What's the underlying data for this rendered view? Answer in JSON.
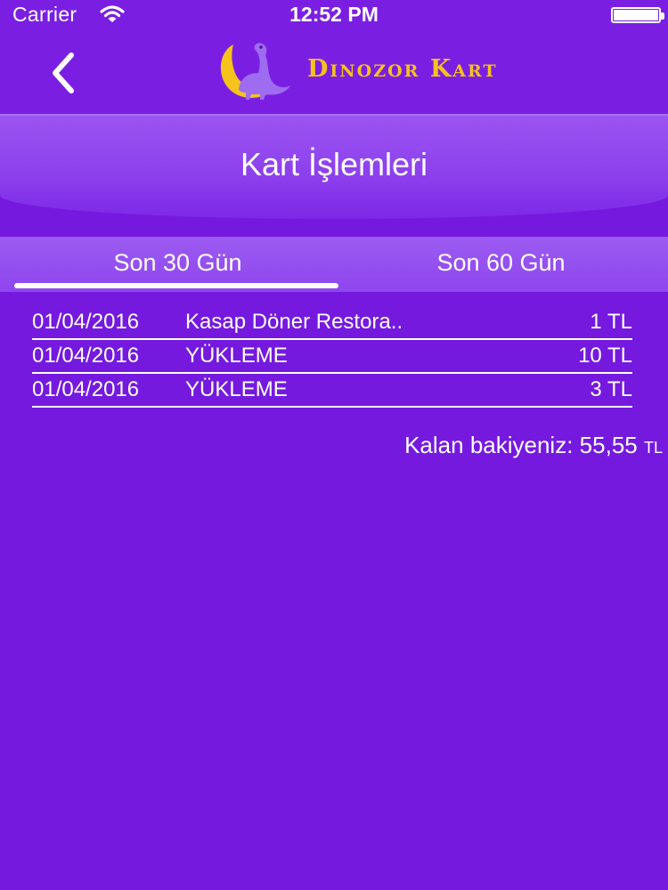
{
  "status_bar": {
    "carrier": "Carrier",
    "time": "12:52 PM"
  },
  "nav": {
    "brand_title": "Dinozor Kart",
    "logo_icon": "dinosaur-moon-icon",
    "back_icon": "chevron-left-icon"
  },
  "header": {
    "title": "Kart İşlemleri"
  },
  "tabs": [
    {
      "label": "Son 30 Gün",
      "active": true
    },
    {
      "label": "Son 60 Gün",
      "active": false
    }
  ],
  "transactions": [
    {
      "date": "01/04/2016",
      "description": "Kasap Döner Restora..",
      "amount": "1 TL"
    },
    {
      "date": "01/04/2016",
      "description": "YÜKLEME",
      "amount": "10 TL"
    },
    {
      "date": "01/04/2016",
      "description": "YÜKLEME",
      "amount": "3 TL"
    }
  ],
  "balance": {
    "label": "Kalan bakiyeniz:",
    "value": "55,55",
    "currency": "TL"
  },
  "colors": {
    "background": "#7519df",
    "header_band": "#8c3fed",
    "brand_gold": "#f6c21c",
    "text": "#ffffff"
  }
}
